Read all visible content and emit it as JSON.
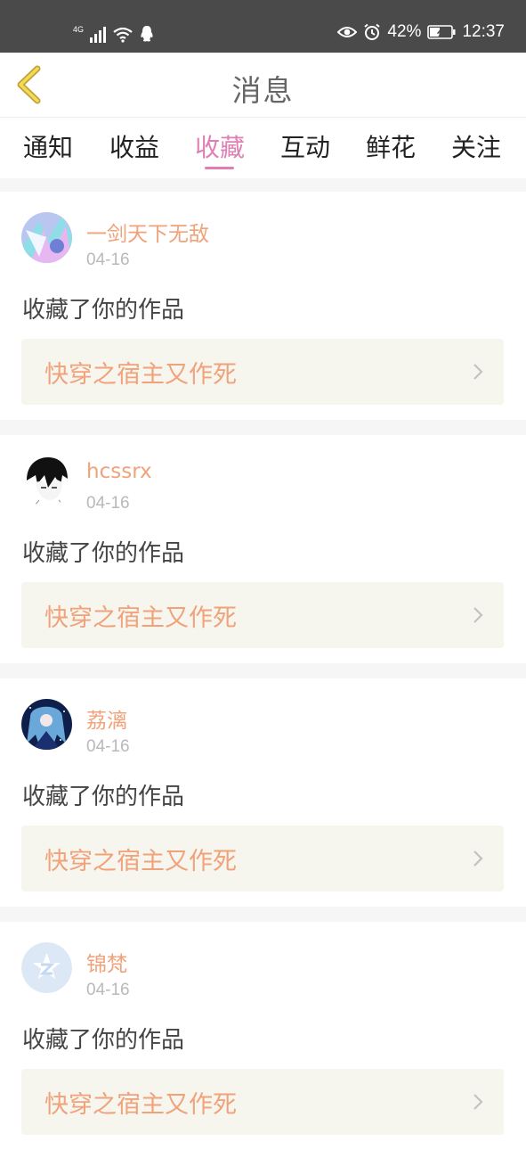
{
  "status": {
    "network": "4G",
    "battery": "42%",
    "time": "12:37"
  },
  "nav": {
    "title": "消息"
  },
  "tabs": [
    {
      "label": "通知",
      "active": false
    },
    {
      "label": "收益",
      "active": false
    },
    {
      "label": "收藏",
      "active": true
    },
    {
      "label": "互动",
      "active": false
    },
    {
      "label": "鲜花",
      "active": false
    },
    {
      "label": "关注",
      "active": false
    }
  ],
  "colors": {
    "accent": "#e07fb3",
    "name": "#f0a27a",
    "work_bg": "#f6f6ef"
  },
  "messages": [
    {
      "username": "一剑天下无敌",
      "date": "04-16",
      "action": "收藏了你的作品",
      "work": "快穿之宿主又作死"
    },
    {
      "username": "hcssrx",
      "date": "04-16",
      "action": "收藏了你的作品",
      "work": "快穿之宿主又作死"
    },
    {
      "username": "荔漓",
      "date": "04-16",
      "action": "收藏了你的作品",
      "work": "快穿之宿主又作死"
    },
    {
      "username": "锦梵",
      "date": "04-16",
      "action": "收藏了你的作品",
      "work": "快穿之宿主又作死"
    }
  ]
}
